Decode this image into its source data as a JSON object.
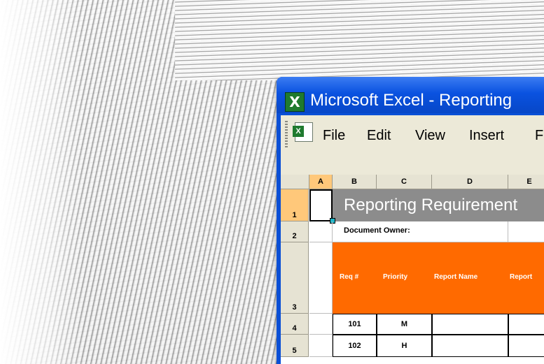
{
  "window": {
    "title": "Microsoft Excel - Reporting",
    "app_icon_letter": "X"
  },
  "menu": {
    "items": [
      {
        "label": "File",
        "name": "menu-file"
      },
      {
        "label": "Edit",
        "name": "menu-edit"
      },
      {
        "label": "View",
        "name": "menu-view"
      },
      {
        "label": "Insert",
        "name": "menu-insert"
      },
      {
        "label": "F",
        "name": "menu-format"
      }
    ]
  },
  "sheet": {
    "columns": [
      "A",
      "B",
      "C",
      "D",
      "E"
    ],
    "rows": [
      "1",
      "2",
      "3",
      "4",
      "5"
    ],
    "title": "Reporting Requirement",
    "owner_label": "Document Owner:",
    "table_headers": [
      "Req #",
      "Priority",
      "Report Name",
      "Report"
    ],
    "data_rows": [
      {
        "req": "101",
        "priority": "M"
      },
      {
        "req": "102",
        "priority": "H"
      }
    ]
  },
  "colors": {
    "title_bar": "#0a52e0",
    "header_band": "#ff6a00",
    "title_band": "#8c8c8c"
  }
}
